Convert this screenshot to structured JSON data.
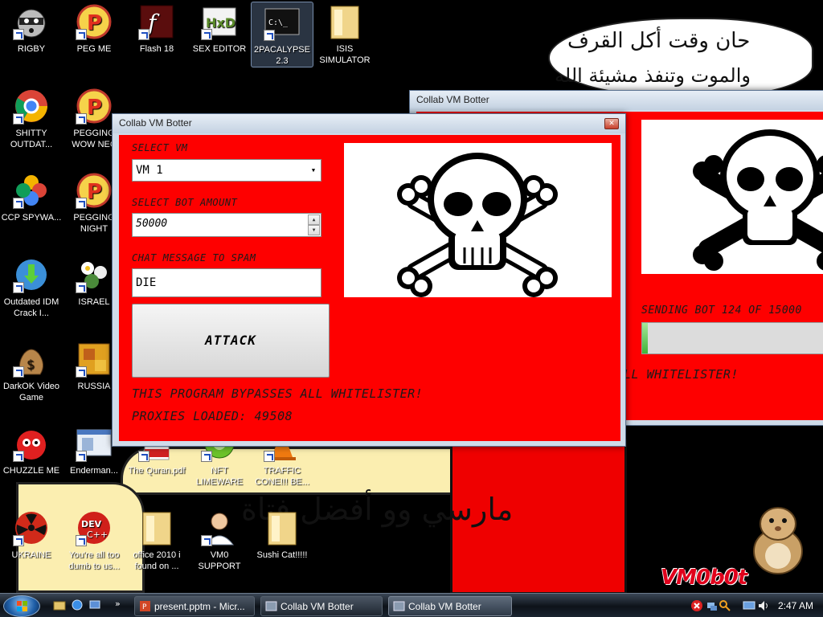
{
  "wallpaper": {
    "arabic_top_line1": "حان وقت أكل القرف",
    "arabic_top_line2": "والموت وتنفذ مشيئة الله",
    "arabic_bottom": "مارسي وو أفضل فتاة",
    "logo": "VM0b0t"
  },
  "desktop_icons": [
    {
      "label": "RIGBY",
      "icon": "raccoon-icon"
    },
    {
      "label": "PEG ME",
      "icon": "p-logo-icon"
    },
    {
      "label": "Flash 18",
      "icon": "flash-icon"
    },
    {
      "label": "SEX EDITOR",
      "icon": "hxd-icon"
    },
    {
      "label": "2PACALYPSE 2.3",
      "icon": "terminal-icon"
    },
    {
      "label": "ISIS SIMULATOR",
      "icon": "folder-icon"
    },
    {
      "label": "SHITTY OUTDAT...",
      "icon": "chrome-icon"
    },
    {
      "label": "PEGGING WOW NEC",
      "icon": "p-logo-icon"
    },
    {
      "label": "CCP SPYWA...",
      "icon": "photos-icon"
    },
    {
      "label": "PEGGING NIGHT",
      "icon": "p-logo-icon"
    },
    {
      "label": "Outdated IDM Crack I...",
      "icon": "idm-icon"
    },
    {
      "label": "ISRAEL",
      "icon": "flowers-icon"
    },
    {
      "label": "DarkOK Video Game",
      "icon": "money-bag-icon"
    },
    {
      "label": "RUSSIA",
      "icon": "game-icon"
    },
    {
      "label": "CHUZZLE ME",
      "icon": "chuzzle-icon"
    },
    {
      "label": "Enderman...",
      "icon": "window-icon"
    },
    {
      "label": "The Quran.pdf",
      "icon": "pdf-icon"
    },
    {
      "label": "NFT LIMEWARE",
      "icon": "limewire-icon"
    },
    {
      "label": "TRAFFIC CONE!!! BE...",
      "icon": "cone-icon"
    },
    {
      "label": "UKRAINE",
      "icon": "radiation-icon"
    },
    {
      "label": "You're all too dumb to us...",
      "icon": "devcpp-icon"
    },
    {
      "label": "office 2010 i found on ...",
      "icon": "folder-icon"
    },
    {
      "label": "VM0 SUPPORT",
      "icon": "person-icon"
    },
    {
      "label": "Sushi Cat!!!!!",
      "icon": "folder-icon"
    }
  ],
  "back_window": {
    "title": "Collab VM Botter",
    "status": "SENDING BOT 124 OF 15000",
    "progress": 0.03,
    "footer_partial": "LL WHITELISTER!"
  },
  "front_window": {
    "title": "Collab VM Botter",
    "close_glyph": "✕",
    "select_vm_label": "SELECT VM",
    "select_vm_value": "VM 1",
    "bot_amount_label": "SELECT BOT AMOUNT",
    "bot_amount_value": "50000",
    "chat_label": "CHAT MESSAGE TO SPAM",
    "chat_value": "DIE",
    "attack_label": "ATTACK",
    "bypass_text": "THIS PROGRAM BYPASSES ALL WHITELISTER!",
    "proxies_text": "PROXIES LOADED: 49508"
  },
  "taskbar": {
    "buttons": [
      {
        "label": "present.pptm - Micr...",
        "icon": "powerpoint-icon"
      },
      {
        "label": "Collab VM Botter",
        "icon": "app-icon"
      },
      {
        "label": "Collab VM Botter",
        "icon": "app-icon"
      }
    ],
    "clock": "2:47 AM"
  },
  "colors": {
    "app_red": "#fe0000",
    "desktop": "#000000"
  }
}
